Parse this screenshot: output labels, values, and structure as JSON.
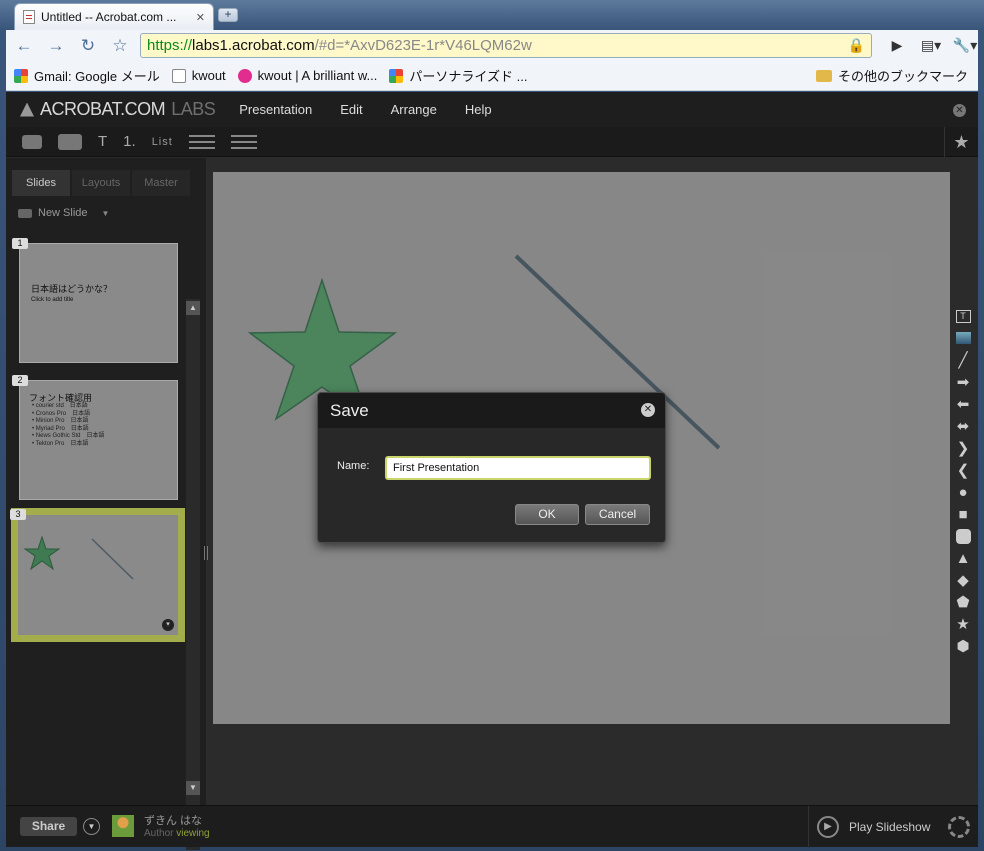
{
  "browser": {
    "tab_title": "Untitled -- Acrobat.com ...",
    "tab_close": "✕",
    "new_tab": "+",
    "url_scheme": "https://",
    "url_host": "labs1.acrobat.com",
    "url_rest": "/#d=*AxvD623E-1r*V46LQM62w",
    "bookmarks": [
      {
        "label": "Gmail: Google メール"
      },
      {
        "label": "kwout"
      },
      {
        "label": "kwout | A brilliant w..."
      },
      {
        "label": "パーソナライズド ..."
      }
    ],
    "bookmarks_other": "その他のブックマーク"
  },
  "app": {
    "logo_text": "ACROBAT.COM",
    "logo_labs": "LABS",
    "menu": [
      "Presentation",
      "Edit",
      "Arrange",
      "Help"
    ],
    "format_toolbar": {
      "number_label": "1.",
      "list_label": "List"
    },
    "panel_tabs": [
      "Slides",
      "Layouts",
      "Master"
    ],
    "new_slide": "New Slide",
    "slides": [
      {
        "number": "1",
        "title": "日本語はどうかな？",
        "subtitle": "Click to add title"
      },
      {
        "number": "2",
        "title": "フォント確認用",
        "items": [
          "• courier std　日本語",
          "• Cronos Pro　日本語",
          "• Minion Pro　日本語",
          "• Myriad Pro　日本語",
          "• News Gothic Std　日本語",
          "• Tekton Pro　日本語"
        ]
      },
      {
        "number": "3"
      }
    ],
    "bottom": {
      "share": "Share",
      "user_name": "ずきん はな",
      "user_role": "Author",
      "user_status": "viewing",
      "play": "Play Slideshow"
    }
  },
  "dialog": {
    "title": "Save",
    "name_label": "Name:",
    "name_value": "First Presentation",
    "ok": "OK",
    "cancel": "Cancel"
  }
}
